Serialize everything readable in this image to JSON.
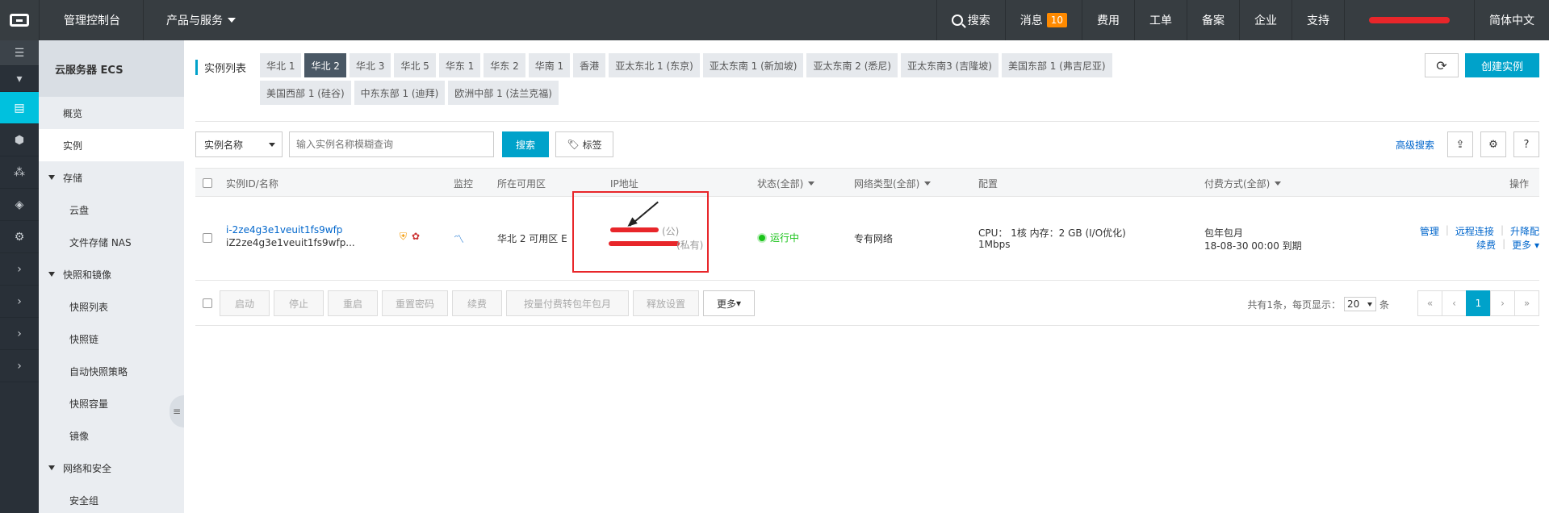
{
  "topbar": {
    "console": "管理控制台",
    "products": "产品与服务",
    "search": "搜索",
    "messages": "消息",
    "messages_count": "10",
    "billing": "费用",
    "ticket": "工单",
    "beian": "备案",
    "enterprise": "企业",
    "support": "支持",
    "language": "简体中文"
  },
  "sidebar": {
    "title": "云服务器 ECS",
    "overview": "概览",
    "instances": "实例",
    "storage_group": "存储",
    "cloud_disk": "云盘",
    "nas": "文件存储 NAS",
    "snapshot_group": "快照和镜像",
    "snapshot_list": "快照列表",
    "snapshot_chain": "快照链",
    "auto_snapshot": "自动快照策略",
    "snapshot_capacity": "快照容量",
    "images": "镜像",
    "network_group": "网络和安全",
    "security_group": "安全组"
  },
  "main": {
    "region_label": "实例列表",
    "regions": [
      "华北 1",
      "华北 2",
      "华北 3",
      "华北 5",
      "华东 1",
      "华东 2",
      "华南 1",
      "香港",
      "亚太东北 1 (东京)",
      "亚太东南 1 (新加坡)",
      "亚太东南 2 (悉尼)",
      "亚太东南3 (吉隆坡)",
      "美国东部 1 (弗吉尼亚)",
      "美国西部 1 (硅谷)",
      "中东东部 1 (迪拜)",
      "欧洲中部 1 (法兰克福)"
    ],
    "active_region": "华北 2",
    "create_button": "创建实例",
    "search_select": "实例名称",
    "search_placeholder": "输入实例名称模糊查询",
    "search_button": "搜索",
    "tag_button": "标签",
    "advanced_search": "高级搜索"
  },
  "table": {
    "headers": {
      "id": "实例ID/名称",
      "monitor": "监控",
      "zone": "所在可用区",
      "ip": "IP地址",
      "status": "状态(全部)",
      "network": "网络类型(全部)",
      "config": "配置",
      "billing": "付费方式(全部)",
      "ops": "操作"
    },
    "row": {
      "instance_id": "i-2ze4g3e1veuit1fs9wfp",
      "instance_name": "iZ2ze4g3e1veuit1fs9wfp...",
      "zone": "华北 2 可用区 E",
      "ip_public_suffix": "(公)",
      "ip_private_suffix": "(私有)",
      "status": "运行中",
      "network": "专有网络",
      "config_line1": "CPU： 1核    内存：2 GB (I/O优化)",
      "config_line2": "1Mbps",
      "billing_line1": "包年包月",
      "billing_line2": "18-08-30 00:00 到期",
      "op_manage": "管理",
      "op_remote": "远程连接",
      "op_upgrade": "升降配",
      "op_renew": "续费",
      "op_more": "更多"
    }
  },
  "footer": {
    "buttons": [
      "启动",
      "停止",
      "重启",
      "重置密码",
      "续费",
      "按量付费转包年包月",
      "释放设置"
    ],
    "more": "更多",
    "total": "共有1条，每页显示：",
    "page_size": "20",
    "unit": "条",
    "pages": [
      "«",
      "‹",
      "1",
      "›",
      "»"
    ]
  },
  "colors": {
    "topbar": "#373d41",
    "accent": "#00a2ca",
    "active_strip": "#00c1de",
    "annotation": "#e8262a"
  }
}
